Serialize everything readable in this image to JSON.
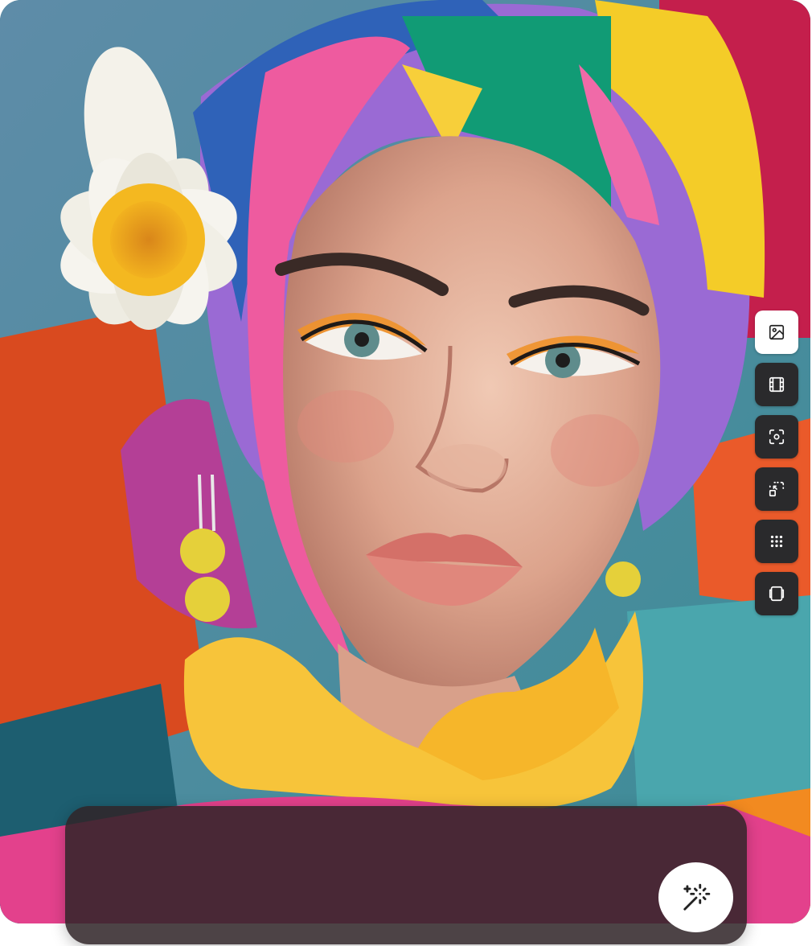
{
  "canvas": {
    "image_subject": "portrait-photo"
  },
  "toolbar": {
    "items": [
      {
        "icon": "image-icon",
        "active": true
      },
      {
        "icon": "film-icon",
        "active": false
      },
      {
        "icon": "focus-icon",
        "active": false
      },
      {
        "icon": "resize-icon",
        "active": false
      },
      {
        "icon": "grid-icon",
        "active": false
      },
      {
        "icon": "layers-icon",
        "active": false
      }
    ]
  },
  "prompt": {
    "value": "",
    "placeholder": ""
  },
  "generate_button": {
    "icon": "magic-wand-icon"
  },
  "colors": {
    "toolbar_bg": "#2a2a2c",
    "toolbar_active_bg": "#ffffff",
    "panel_bg": "#302428",
    "accent": "#ffffff"
  }
}
